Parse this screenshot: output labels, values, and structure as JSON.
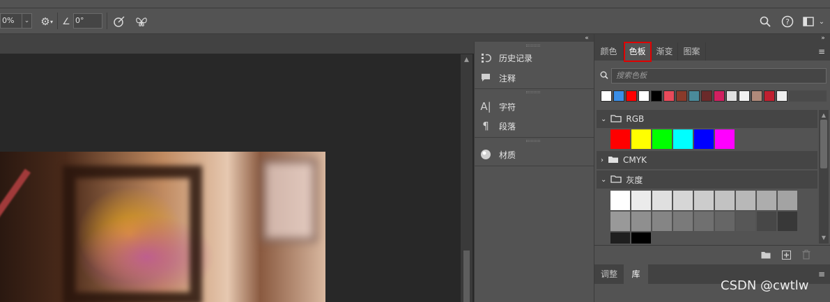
{
  "options": {
    "zoom_value": "0%",
    "angle_value": "0°"
  },
  "middle_panel": {
    "items": [
      {
        "label": "历史记录"
      },
      {
        "label": "注释"
      },
      {
        "label": "字符"
      },
      {
        "label": "段落"
      },
      {
        "label": "材质"
      }
    ]
  },
  "swatches_panel": {
    "tabs": [
      {
        "label": "颜色"
      },
      {
        "label": "色板"
      },
      {
        "label": "渐变"
      },
      {
        "label": "图案"
      }
    ],
    "active_tab": "色板",
    "search_placeholder": "搜索色板",
    "recent_colors": [
      "#ffffff",
      "#3a8ee6",
      "#ff0000",
      "#ffffff",
      "#000000",
      "#e84a5a",
      "#8a3a2a",
      "#4a8a9a",
      "#6a2a2a",
      "#d02060",
      "#e0e0e0",
      "#f0f0f0",
      "#b08a7a",
      "#c02030",
      "#f0f0f0"
    ],
    "groups": [
      {
        "name": "RGB",
        "expanded": true,
        "colors": [
          "#ff0000",
          "#ffff00",
          "#00ff00",
          "#00ffff",
          "#0000ff",
          "#ff00ff"
        ]
      },
      {
        "name": "CMYK",
        "expanded": false
      },
      {
        "name": "灰度",
        "expanded": true,
        "rows": [
          [
            "#ffffff",
            "#ebebeb",
            "#e0e0e0",
            "#d6d6d6",
            "#cccccc",
            "#c2c2c2",
            "#b8b8b8",
            "#adadad",
            "#a3a3a3"
          ],
          [
            "#999999",
            "#8f8f8f",
            "#858585",
            "#7a7a7a",
            "#707070",
            "#666666",
            "#575757",
            "#474747",
            "#383838"
          ],
          [
            "#1f1f1f",
            "#000000"
          ]
        ]
      }
    ]
  },
  "bottom_panel": {
    "tabs": [
      {
        "label": "调整"
      },
      {
        "label": "库"
      }
    ],
    "active_tab": "库"
  },
  "watermark": "CSDN @cwtlw"
}
